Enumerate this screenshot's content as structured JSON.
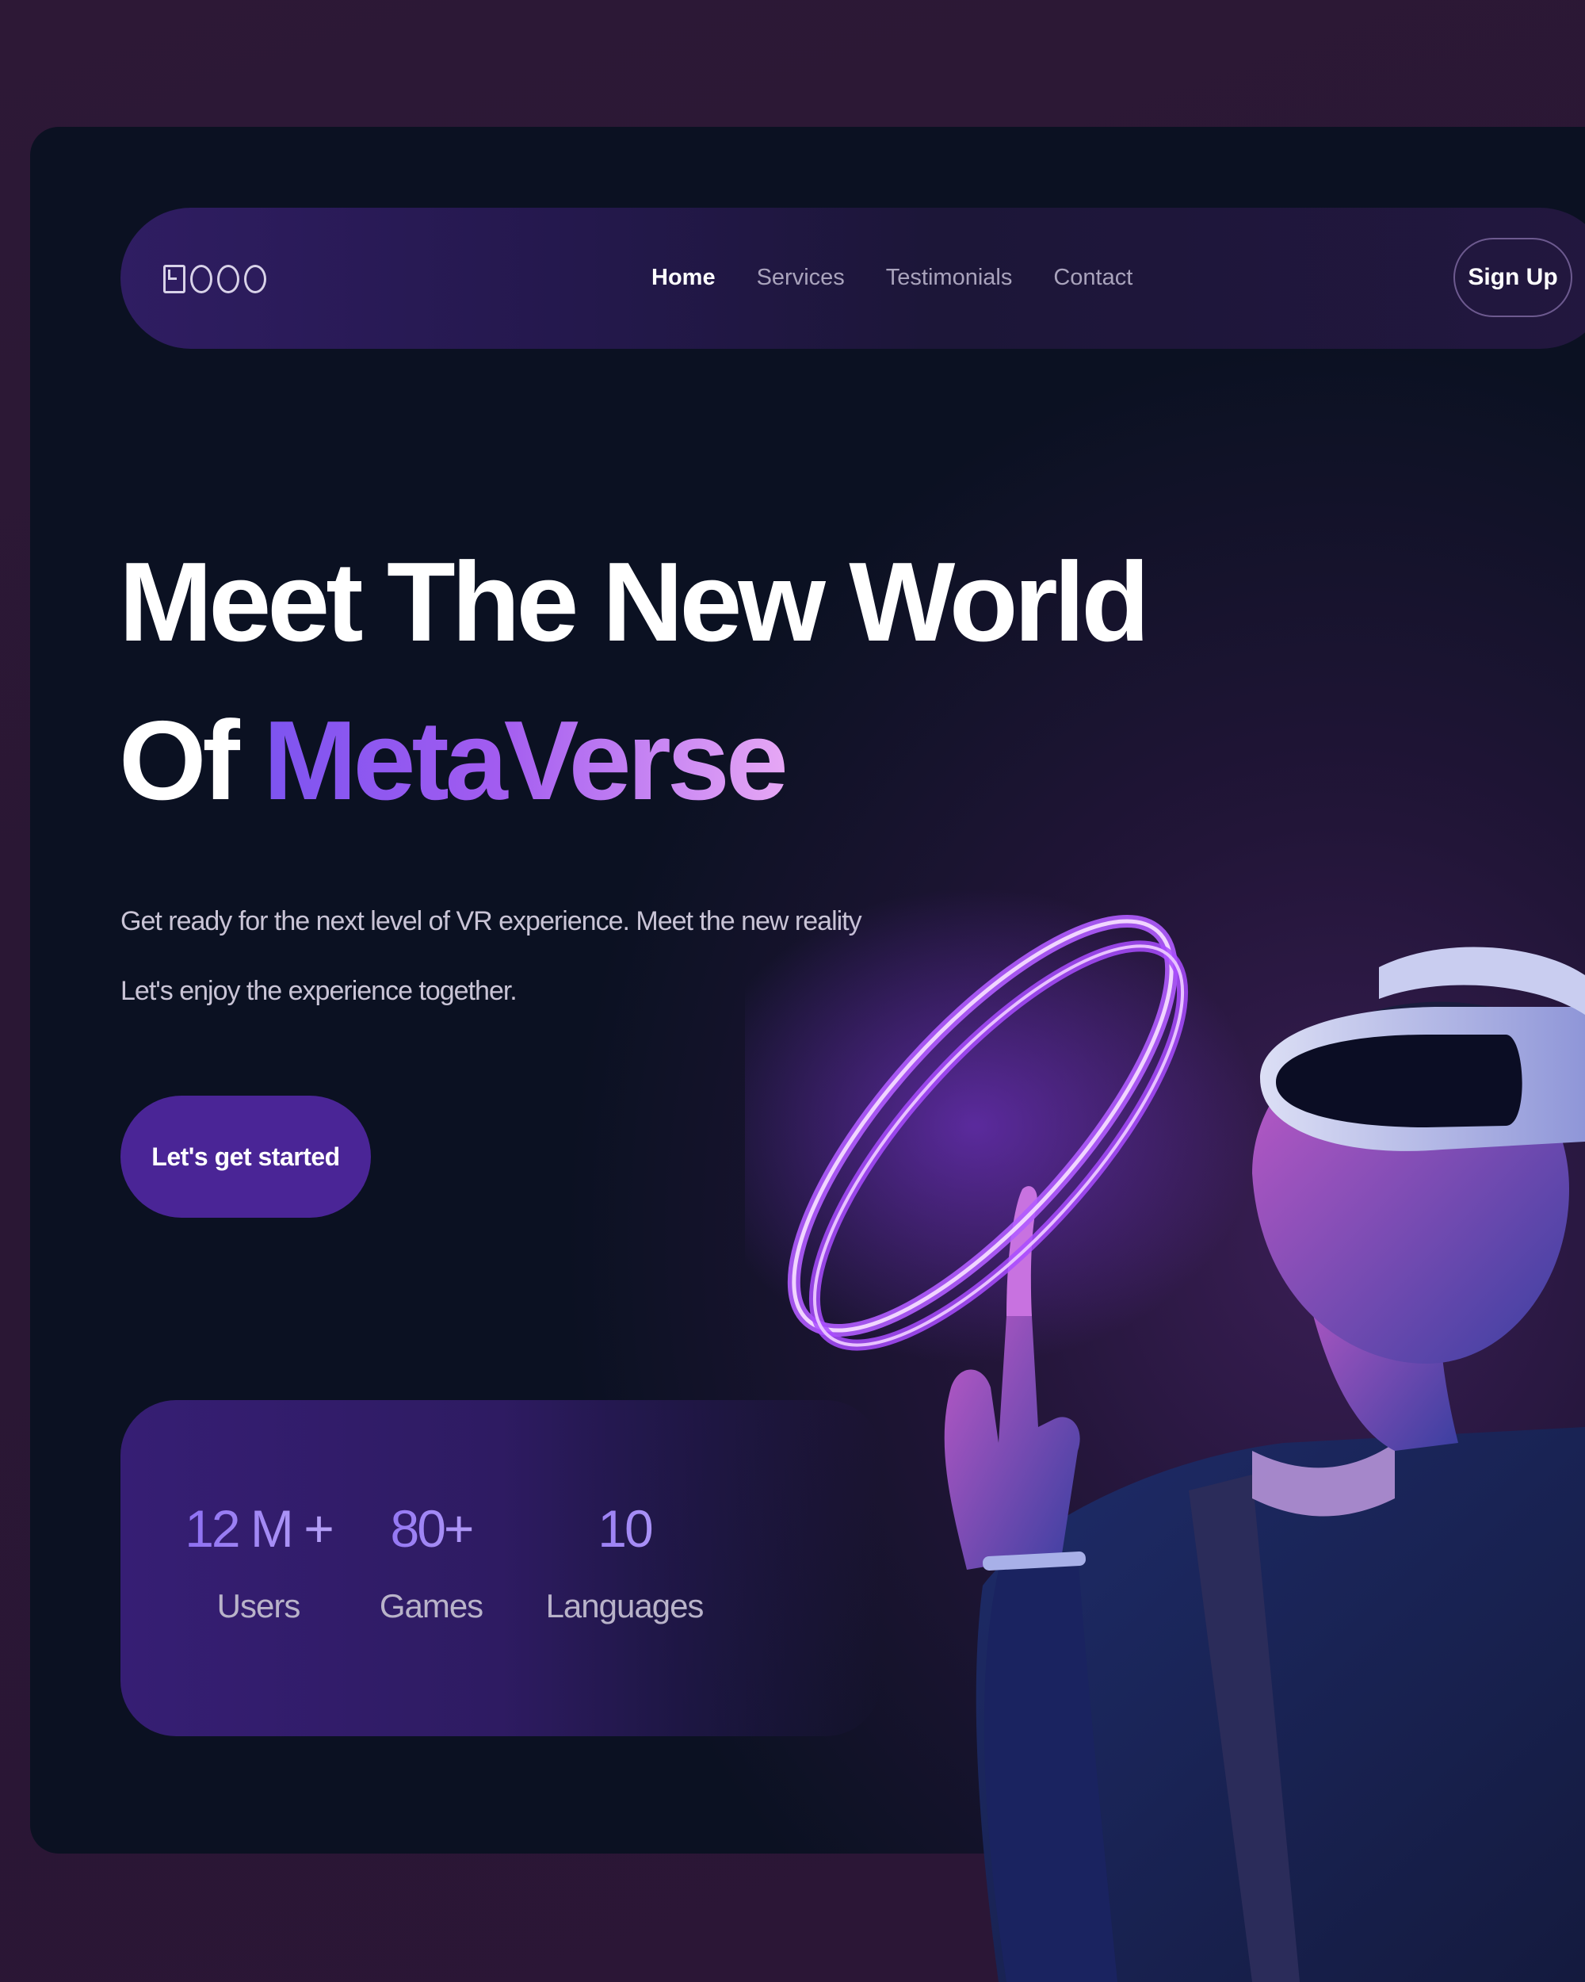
{
  "brand": {
    "logo_text": "LOGO",
    "logo_icon": "logo-mark"
  },
  "nav": {
    "links": [
      {
        "label": "Home",
        "active": true
      },
      {
        "label": "Services",
        "active": false
      },
      {
        "label": "Testimonials",
        "active": false
      },
      {
        "label": "Contact",
        "active": false
      }
    ],
    "signup_label": "Sign Up"
  },
  "hero": {
    "headline_line1": "Meet The New World",
    "headline_line2_plain": "Of ",
    "headline_line2_accent": "MetaVerse",
    "subtext_line1": "Get ready for the next level of VR experience. Meet the new reality",
    "subtext_line2": "Let's enjoy the experience together.",
    "cta_label": "Let's get started"
  },
  "stats": [
    {
      "value": "12 M +",
      "label": "Users"
    },
    {
      "value": "80+",
      "label": "Games"
    },
    {
      "value": "10",
      "label": "Languages"
    }
  ],
  "colors": {
    "accent_purple": "#4a2596",
    "gradient_start": "#7d54f0",
    "gradient_end": "#e6a7f5",
    "card_dark": "#0a1224",
    "background": "#2d1836"
  },
  "illustration": "person-wearing-vr-headset-with-neon-ring"
}
